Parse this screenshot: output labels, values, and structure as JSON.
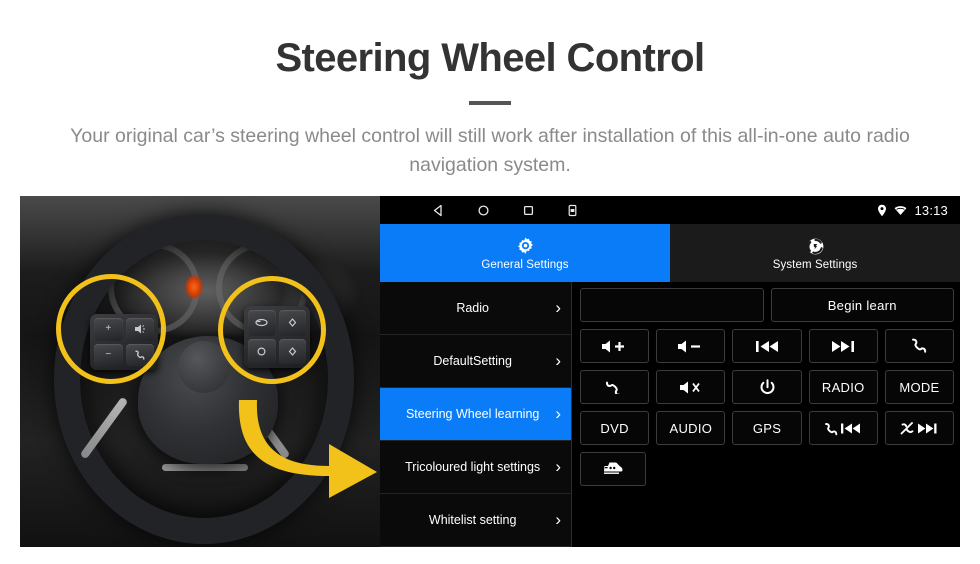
{
  "header": {
    "title": "Steering Wheel Control",
    "subtitle": "Your original car’s steering wheel control will still work after installation of this all-in-one auto radio navigation system."
  },
  "colors": {
    "accent_blue": "#0B7CF8",
    "highlight_yellow": "#F2C21B",
    "title_gray": "#333333",
    "subtitle_gray": "#8A8A8A"
  },
  "photo": {
    "alt_name": "steering-wheel-photo",
    "highlight_left": "left-control-pad-highlight",
    "highlight_right": "right-control-pad-highlight",
    "arrow": "yellow-curved-arrow"
  },
  "device": {
    "statusbar": {
      "nav_icons": [
        "back-icon",
        "home-icon",
        "recents-icon",
        "screenshot-icon"
      ],
      "right_icons": [
        "location-pin-icon",
        "wifi-icon"
      ],
      "time": "13:13"
    },
    "tabs": [
      {
        "label": "General Settings",
        "icon": "gear-icon",
        "active": true
      },
      {
        "label": "System Settings",
        "icon": "shutter-icon",
        "active": false
      }
    ],
    "sidebar": [
      {
        "label": "Radio",
        "selected": false
      },
      {
        "label": "DefaultSetting",
        "selected": false
      },
      {
        "label": "Steering Wheel learning",
        "selected": true
      },
      {
        "label": "Tricoloured light settings",
        "selected": false
      },
      {
        "label": "Whitelist setting",
        "selected": false
      }
    ],
    "learn_field": {
      "value": "",
      "placeholder": ""
    },
    "begin_learn_label": "Begin learn",
    "keys": [
      [
        {
          "name": "volume-up-key",
          "icon": "speaker-plus-icon",
          "label": ""
        },
        {
          "name": "volume-down-key",
          "icon": "speaker-minus-icon",
          "label": ""
        },
        {
          "name": "previous-track-key",
          "icon": "previous-icon",
          "label": ""
        },
        {
          "name": "next-track-key",
          "icon": "next-icon",
          "label": ""
        },
        {
          "name": "call-answer-key",
          "icon": "phone-icon",
          "label": ""
        }
      ],
      [
        {
          "name": "call-hangup-key",
          "icon": "phone-hangup-icon",
          "label": ""
        },
        {
          "name": "mute-key",
          "icon": "speaker-mute-icon",
          "label": ""
        },
        {
          "name": "power-key",
          "icon": "power-icon",
          "label": ""
        },
        {
          "name": "radio-key",
          "icon": "",
          "label": "RADIO"
        },
        {
          "name": "mode-key",
          "icon": "",
          "label": "MODE"
        }
      ],
      [
        {
          "name": "dvd-key",
          "icon": "",
          "label": "DVD"
        },
        {
          "name": "audio-key",
          "icon": "",
          "label": "AUDIO"
        },
        {
          "name": "gps-key",
          "icon": "",
          "label": "GPS"
        },
        {
          "name": "call-previous-key",
          "icon": "phone-previous-icon",
          "label": ""
        },
        {
          "name": "call-reject-next-key",
          "icon": "phone-reject-next-icon",
          "label": ""
        }
      ],
      [
        {
          "name": "vehicle-info-key",
          "icon": "car-icon",
          "label": ""
        }
      ]
    ]
  }
}
